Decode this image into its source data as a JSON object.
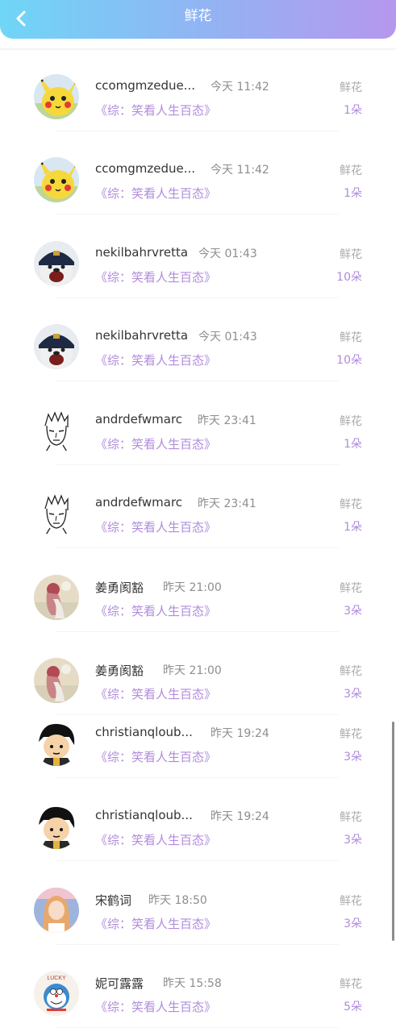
{
  "header": {
    "title": "鲜花",
    "back_icon": "chevron-left-icon",
    "gradient_start": "#6fd6f6",
    "gradient_end": "#b697ee"
  },
  "colors": {
    "accent": "#b08bdc",
    "muted": "#aaaaaa"
  },
  "records": [
    {
      "user": "ccomgmzedue...",
      "time": "今天 11:42",
      "book": "《综：笑看人生百态》",
      "gift_label": "鲜花",
      "count": "1朵",
      "avatar": "pikachu"
    },
    {
      "user": "ccomgmzedue...",
      "time": "今天 11:42",
      "book": "《综：笑看人生百态》",
      "gift_label": "鲜花",
      "count": "1朵",
      "avatar": "pikachu"
    },
    {
      "user": "nekilbahrvretta",
      "time": "今天 01:43",
      "book": "《综：笑看人生百态》",
      "gift_label": "鲜花",
      "count": "10朵",
      "avatar": "pilot-bear"
    },
    {
      "user": "nekilbahrvretta",
      "time": "今天 01:43",
      "book": "《综：笑看人生百态》",
      "gift_label": "鲜花",
      "count": "10朵",
      "avatar": "pilot-bear"
    },
    {
      "user": "andrdefwmarc",
      "time": "昨天 23:41",
      "book": "《综：笑看人生百态》",
      "gift_label": "鲜花",
      "count": "1朵",
      "avatar": "sketch-man"
    },
    {
      "user": "andrdefwmarc",
      "time": "昨天 23:41",
      "book": "《综：笑看人生百态》",
      "gift_label": "鲜花",
      "count": "1朵",
      "avatar": "sketch-man"
    },
    {
      "user": "姜勇阂豁",
      "time": "昨天 21:00",
      "book": "《综：笑看人生百态》",
      "gift_label": "鲜花",
      "count": "3朵",
      "avatar": "girl-photo"
    },
    {
      "user": "姜勇阂豁",
      "time": "昨天 21:00",
      "book": "《综：笑看人生百态》",
      "gift_label": "鲜花",
      "count": "3朵",
      "avatar": "girl-photo"
    },
    {
      "user": "christianqloub...",
      "time": "昨天 19:24",
      "book": "《综：笑看人生百态》",
      "gift_label": "鲜花",
      "count": "3朵",
      "avatar": "cartoon-boy"
    },
    {
      "user": "christianqloub...",
      "time": "昨天 19:24",
      "book": "《综：笑看人生百态》",
      "gift_label": "鲜花",
      "count": "3朵",
      "avatar": "cartoon-boy"
    },
    {
      "user": "宋鹤词",
      "time": "昨天 18:50",
      "book": "《综：笑看人生百态》",
      "gift_label": "鲜花",
      "count": "3朵",
      "avatar": "blonde-girl"
    },
    {
      "user": "妮可露露",
      "time": "昨天 15:58",
      "book": "《综：笑看人生百态》",
      "gift_label": "鲜花",
      "count": "5朵",
      "avatar": "doraemon"
    }
  ]
}
